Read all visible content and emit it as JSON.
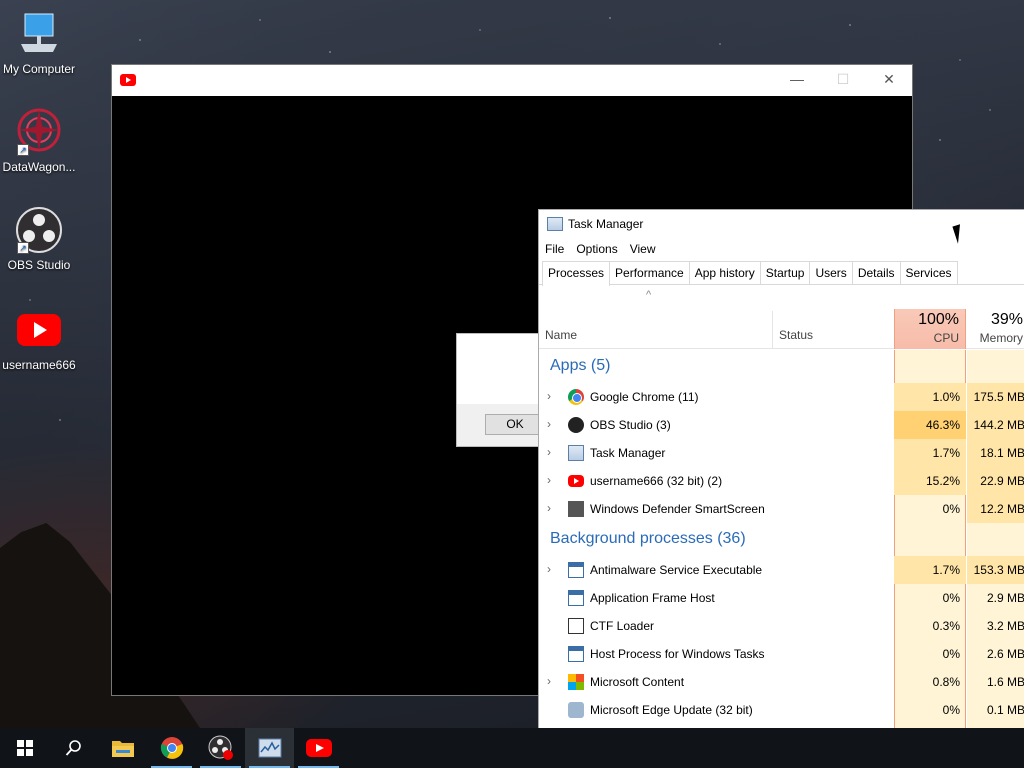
{
  "desktop": {
    "icons": [
      {
        "label": "My Computer"
      },
      {
        "label": "DataWagon..."
      },
      {
        "label": "OBS Studio"
      },
      {
        "label": "username666"
      }
    ]
  },
  "youtube_window": {
    "controls": {
      "minimize": "—",
      "maximize": "☐",
      "close": "✕"
    }
  },
  "dialog": {
    "ok_label": "OK"
  },
  "task_manager": {
    "title": "Task Manager",
    "menu": [
      "File",
      "Options",
      "View"
    ],
    "tabs": [
      "Processes",
      "Performance",
      "App history",
      "Startup",
      "Users",
      "Details",
      "Services"
    ],
    "active_tab": "Processes",
    "columns": {
      "name": "Name",
      "status": "Status",
      "cpu_pct": "100%",
      "cpu": "CPU",
      "mem_pct": "39%",
      "mem": "Memory"
    },
    "groups": {
      "apps": "Apps (5)",
      "background": "Background processes (36)"
    },
    "apps": [
      {
        "name": "Google Chrome (11)",
        "cpu": "1.0%",
        "mem": "175.5 MB",
        "icon": "chrome-icon"
      },
      {
        "name": "OBS Studio (3)",
        "cpu": "46.3%",
        "mem": "144.2 MB",
        "icon": "obs-icon"
      },
      {
        "name": "Task Manager",
        "cpu": "1.7%",
        "mem": "18.1 MB",
        "icon": "task-manager-icon"
      },
      {
        "name": "username666 (32 bit) (2)",
        "cpu": "15.2%",
        "mem": "22.9 MB",
        "icon": "youtube-icon"
      },
      {
        "name": "Windows Defender SmartScreen",
        "cpu": "0%",
        "mem": "12.2 MB",
        "icon": "defender-icon"
      }
    ],
    "background": [
      {
        "name": "Antimalware Service Executable",
        "cpu": "1.7%",
        "mem": "153.3 MB",
        "icon": "window-icon"
      },
      {
        "name": "Application Frame Host",
        "cpu": "0%",
        "mem": "2.9 MB",
        "icon": "window-icon"
      },
      {
        "name": "CTF Loader",
        "cpu": "0.3%",
        "mem": "3.2 MB",
        "icon": "ctf-icon"
      },
      {
        "name": "Host Process for Windows Tasks",
        "cpu": "0%",
        "mem": "2.6 MB",
        "icon": "window-icon"
      },
      {
        "name": "Microsoft Content",
        "cpu": "0.8%",
        "mem": "1.6 MB",
        "icon": "microsoft-icon"
      },
      {
        "name": "Microsoft Edge Update (32 bit)",
        "cpu": "0%",
        "mem": "0.1 MB",
        "icon": "edge-update-icon"
      }
    ]
  },
  "taskbar": {
    "items": [
      "start-icon",
      "search-icon",
      "file-explorer-icon",
      "chrome-icon",
      "obs-icon",
      "task-manager-icon",
      "youtube-icon"
    ]
  }
}
